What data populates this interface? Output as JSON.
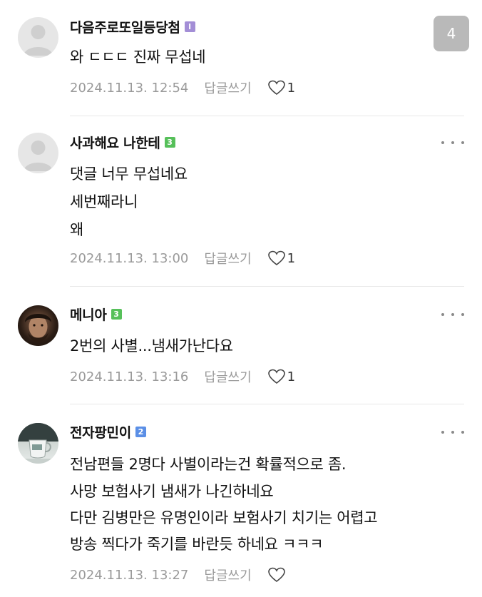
{
  "overlay": {
    "page_indicator": "4"
  },
  "comments": [
    {
      "nickname": "다음주로또일등당첨",
      "level": "l",
      "lines": [
        "와 ㄷㄷㄷ 진짜 무섭네"
      ],
      "timestamp": "2024.11.13. 12:54",
      "reply_label": "답글쓰기",
      "likes": "1"
    },
    {
      "nickname": "사과해요 나한테",
      "level": "3",
      "lines": [
        "댓글 너무 무섭네요",
        "세번째라니",
        "왜"
      ],
      "timestamp": "2024.11.13. 13:00",
      "reply_label": "답글쓰기",
      "likes": "1"
    },
    {
      "nickname": "메니아",
      "level": "3",
      "lines": [
        "2번의 사별...냄새가난다요"
      ],
      "timestamp": "2024.11.13. 13:16",
      "reply_label": "답글쓰기",
      "likes": "1"
    },
    {
      "nickname": "전자팡민이",
      "level": "2",
      "lines": [
        "전남편들 2명다 사별이라는건 확률적으로 좀.",
        "사망 보험사기 냄새가 나긴하네요",
        "다만 김병만은 유명인이라 보험사기 치기는 어렵고",
        "방송 찍다가 죽기를 바란듯 하네요 ㅋㅋㅋ"
      ],
      "timestamp": "2024.11.13. 13:27",
      "reply_label": "답글쓰기",
      "likes": ""
    }
  ]
}
